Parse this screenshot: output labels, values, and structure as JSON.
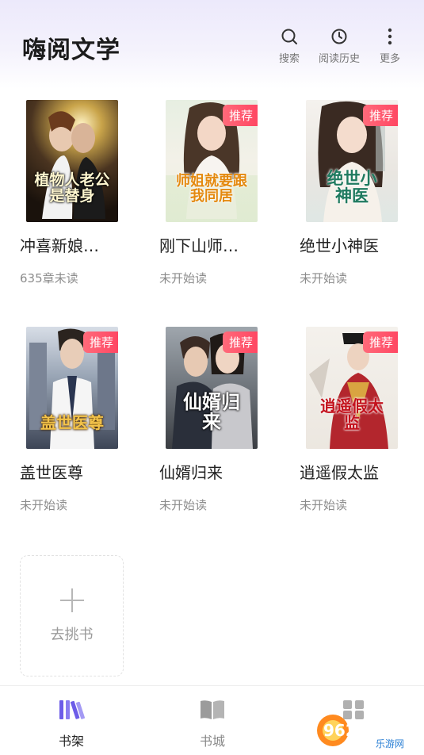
{
  "header": {
    "title": "嗨阅文学",
    "actions": [
      {
        "label": "搜索",
        "icon": "search-icon"
      },
      {
        "label": "阅读历史",
        "icon": "clock-icon"
      },
      {
        "label": "更多",
        "icon": "more-vertical-icon"
      }
    ]
  },
  "shelf": {
    "books": [
      {
        "title": "冲喜新娘…",
        "status": "635章未读",
        "badge": "",
        "cover_text": "植物人老公是替身"
      },
      {
        "title": "刚下山师…",
        "status": "未开始读",
        "badge": "推荐",
        "cover_text": "师姐就要跟我同居"
      },
      {
        "title": "绝世小神医",
        "status": "未开始读",
        "badge": "推荐",
        "cover_text": "绝世小神医"
      },
      {
        "title": "盖世医尊",
        "status": "未开始读",
        "badge": "推荐",
        "cover_text": "盖世医尊"
      },
      {
        "title": "仙婿归来",
        "status": "未开始读",
        "badge": "推荐",
        "cover_text": "仙婿归来"
      },
      {
        "title": "逍遥假太监",
        "status": "未开始读",
        "badge": "推荐",
        "cover_text": "逍遥假太监"
      }
    ],
    "add_label": "去挑书"
  },
  "tabbar": {
    "tabs": [
      {
        "label": "书架",
        "icon": "bookshelf-icon",
        "active": true
      },
      {
        "label": "书城",
        "icon": "open-book-icon",
        "active": false
      },
      {
        "label": "",
        "icon": "grid-icon",
        "active": false
      }
    ]
  },
  "watermark": {
    "text": "962.NET",
    "subtext": "乐游网"
  },
  "colors": {
    "accent": "#6d5ce8",
    "badge": "#ff4d66",
    "inactive": "#9b9b9b"
  }
}
